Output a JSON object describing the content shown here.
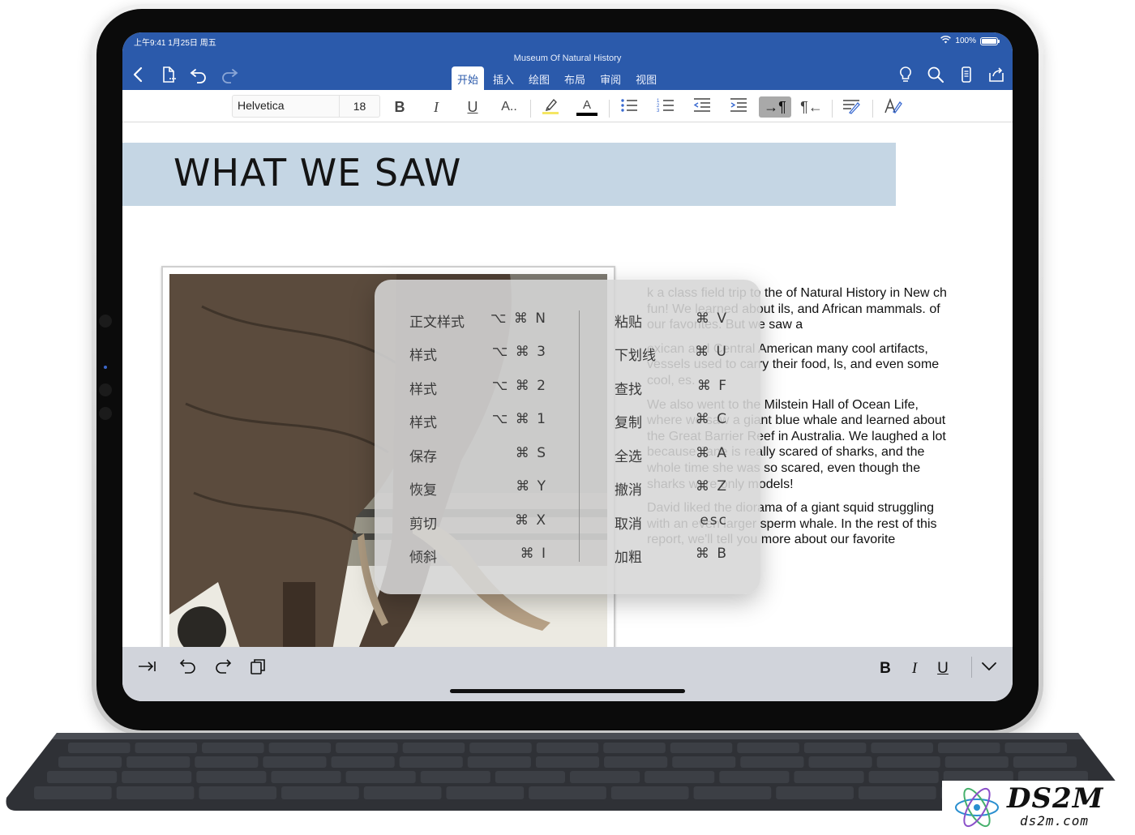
{
  "status_bar": {
    "time": "上午9:41  1月25日 周五",
    "battery": "100%"
  },
  "window": {
    "title": "Museum Of Natural History"
  },
  "ribbon": {
    "tabs": [
      {
        "label": "开始",
        "active": true
      },
      {
        "label": "插入",
        "active": false
      },
      {
        "label": "绘图",
        "active": false
      },
      {
        "label": "布局",
        "active": false
      },
      {
        "label": "审阅",
        "active": false
      },
      {
        "label": "视图",
        "active": false
      }
    ]
  },
  "formatting": {
    "font_name": "Helvetica",
    "font_size": "18",
    "bold": "B",
    "italic": "I",
    "underline": "U",
    "text_effects": "A..",
    "font_color_glyph": "A",
    "font_color": "#000000",
    "highlight_color": "#f5e663",
    "pilcrow": "¶"
  },
  "document": {
    "heading": "WHAT WE SAW",
    "paragraphs": [
      "k a class field trip to the of Natural History in New ch fun! We learned about ils, and African mammals. of our favorites. But we saw a",
      "exican and Central American many cool artifacts, vessels used to carry their food, ls, and even some cool, es.",
      "We also went to the Milstein Hall of Ocean Life, where we saw a giant blue whale and learned about the Great Barrier Reef in Australia. We laughed a lot because Jane is really scared of sharks, and the whole time she was so scared, even though the sharks were only models!",
      "David liked the diorama of a giant squid struggling with an even larger sperm whale. In the rest of this report, we'll tell you more about our favorite"
    ]
  },
  "shortcuts": {
    "left": [
      {
        "label": "正文样式",
        "keys": "⌥ ⌘ N"
      },
      {
        "label": "样式",
        "keys": "⌥ ⌘ 3"
      },
      {
        "label": "样式",
        "keys": "⌥ ⌘ 2"
      },
      {
        "label": "样式",
        "keys": "⌥ ⌘ 1"
      },
      {
        "label": "保存",
        "keys": "⌘ S"
      },
      {
        "label": "恢复",
        "keys": "⌘ Y"
      },
      {
        "label": "剪切",
        "keys": "⌘ X"
      },
      {
        "label": "倾斜",
        "keys": "⌘ I"
      }
    ],
    "right": [
      {
        "label": "粘贴",
        "keys": "⌘ V"
      },
      {
        "label": "下划线",
        "keys": "⌘ U"
      },
      {
        "label": "查找",
        "keys": "⌘ F"
      },
      {
        "label": "复制",
        "keys": "⌘ C"
      },
      {
        "label": "全选",
        "keys": "⌘ A"
      },
      {
        "label": "撤消",
        "keys": "⌘ Z"
      },
      {
        "label": "取消",
        "keys": "esc"
      },
      {
        "label": "加粗",
        "keys": "⌘ B"
      }
    ]
  },
  "accessory_bar": {
    "bold": "B",
    "italic": "I",
    "underline": "U"
  },
  "watermark": {
    "main": "DS2M",
    "sub": "ds2m.com"
  },
  "colors": {
    "app_blue": "#2b5aab",
    "heading_band": "#c5d6e4",
    "overlay": "#d6d6d6"
  }
}
